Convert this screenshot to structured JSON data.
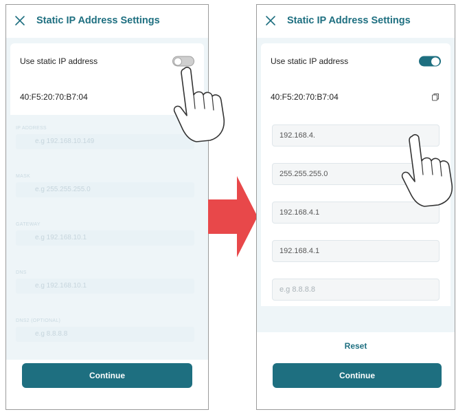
{
  "colors": {
    "brand": "#1e6f80",
    "arrow": "#e8484a",
    "panel_bg": "#eef5f8"
  },
  "left_screen": {
    "header": {
      "title": "Static IP Address Settings",
      "close_icon": "close-icon"
    },
    "toggle_row": {
      "label": "Use static IP address",
      "toggle_state": "off"
    },
    "mac_row": {
      "value": "40:F5:20:70:B7:04"
    },
    "fields": [
      {
        "label": "IP ADDRESS",
        "placeholder": "e.g 192.168.10.149"
      },
      {
        "label": "MASK",
        "placeholder": "e.g 255.255.255.0"
      },
      {
        "label": "GATEWAY",
        "placeholder": "e.g 192.168.10.1"
      },
      {
        "label": "DNS",
        "placeholder": "e.g 192.168.10.1"
      },
      {
        "label": "DNS2 (OPTIONAL)",
        "placeholder": "e.g 8.8.8.8"
      }
    ],
    "continue_label": "Continue"
  },
  "right_screen": {
    "header": {
      "title": "Static IP Address Settings",
      "close_icon": "close-icon"
    },
    "toggle_row": {
      "label": "Use static IP address",
      "toggle_state": "on"
    },
    "mac_row": {
      "value": "40:F5:20:70:B7:04",
      "icon": "copy-icon"
    },
    "fields": [
      {
        "value": "192.168.4."
      },
      {
        "value": "255.255.255.0"
      },
      {
        "value": "192.168.4.1"
      },
      {
        "value": "192.168.4.1"
      },
      {
        "value": "",
        "placeholder": "e.g 8.8.8.8"
      }
    ],
    "reset_label": "Reset",
    "continue_label": "Continue"
  }
}
